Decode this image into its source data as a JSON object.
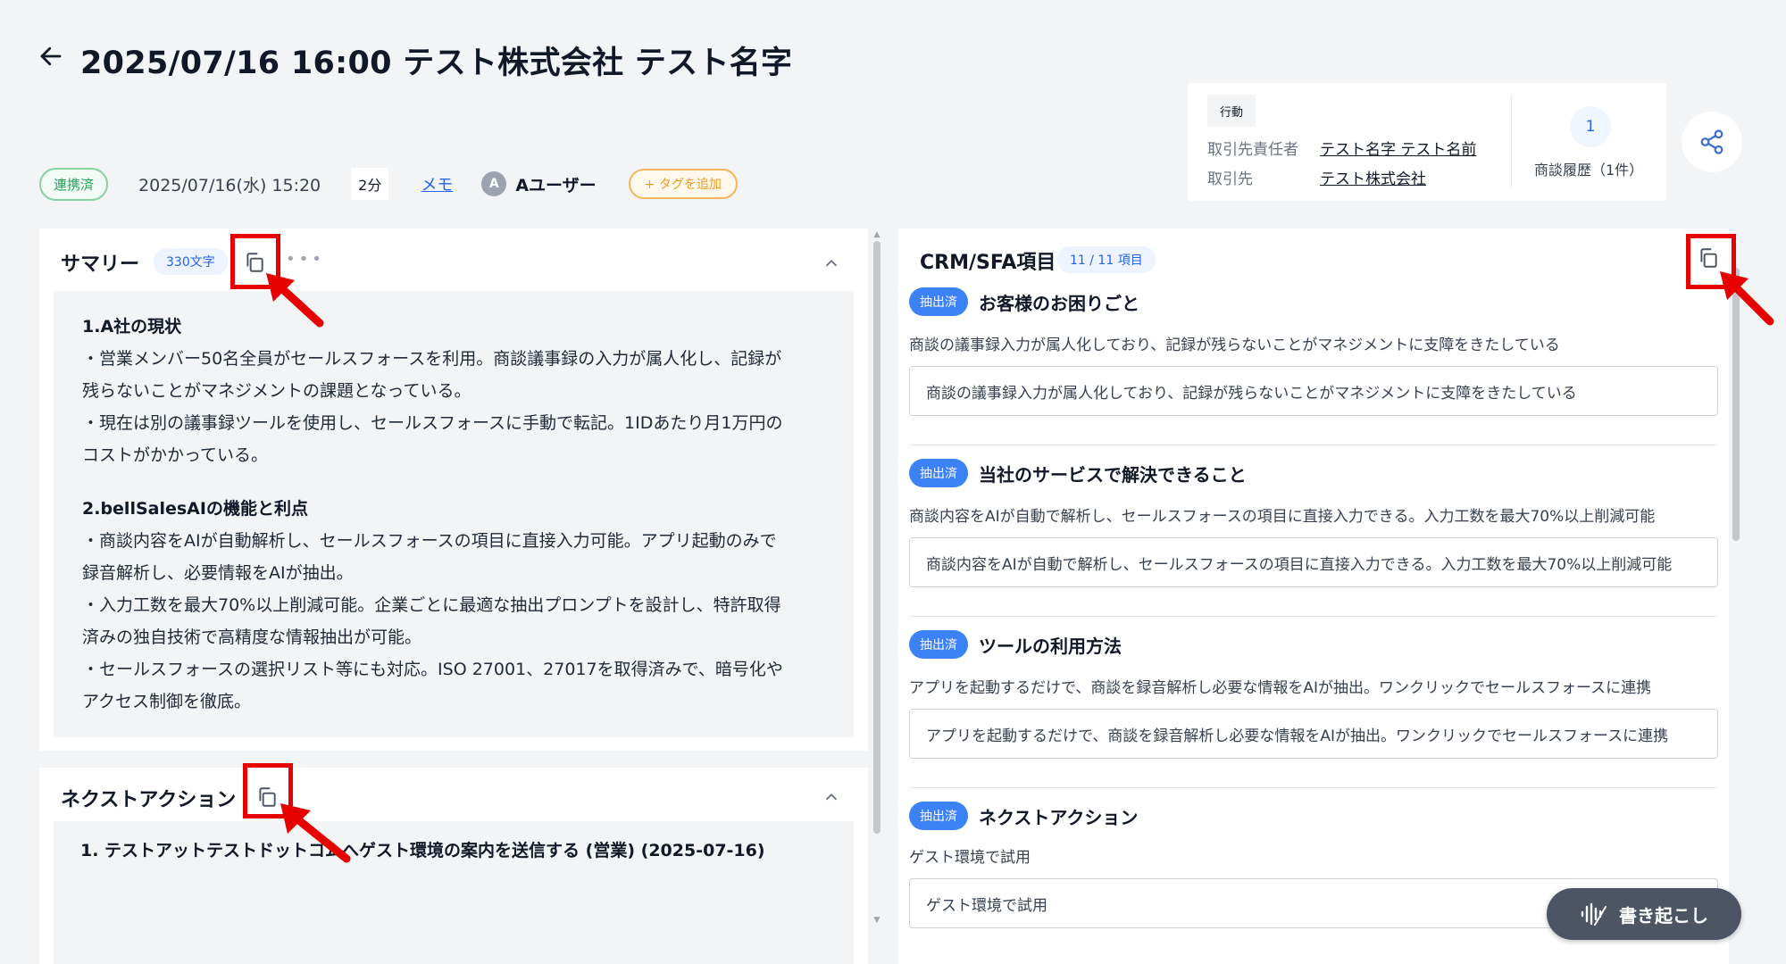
{
  "header": {
    "title": "2025/07/16 16:00 テスト株式会社 テスト名字"
  },
  "meta": {
    "status": "連携済",
    "datetime": "2025/07/16(水) 15:20",
    "duration": "2分",
    "memo": "メモ",
    "avatar_initial": "A",
    "user": "Aユーザー",
    "add_tag": "+ タグを追加"
  },
  "info_card": {
    "action": "行動",
    "contact_label": "取引先責任者",
    "contact_value": "テスト名字 テスト名前",
    "account_label": "取引先",
    "account_value": "テスト株式会社",
    "history_count": "1",
    "history_label": "商談履歴（1件）"
  },
  "summary": {
    "title": "サマリー",
    "count": "330文字",
    "sections": [
      {
        "title": "1.A社の現状",
        "lines": [
          "・営業メンバー50名全員がセールスフォースを利用。商談議事録の入力が属人化し、記録が",
          "残らないことがマネジメントの課題となっている。",
          "・現在は別の議事録ツールを使用し、セールスフォースに手動で転記。1IDあたり月1万円の",
          "コストがかかっている。"
        ]
      },
      {
        "title": "2.bellSalesAIの機能と利点",
        "lines": [
          "・商談内容をAIが自動解析し、セールスフォースの項目に直接入力可能。アプリ起動のみで",
          "録音解析し、必要情報をAIが抽出。",
          "・入力工数を最大70%以上削減可能。企業ごとに最適な抽出プロンプトを設計し、特許取得",
          "済みの独自技術で高精度な情報抽出が可能。",
          "・セールスフォースの選択リスト等にも対応。ISO 27001、27017を取得済みで、暗号化や",
          "アクセス制御を徹底。"
        ]
      }
    ]
  },
  "next_action": {
    "title": "ネクストアクション",
    "items": [
      "1. テストアットテストドットコムへゲスト環境の案内を送信する (営業) (2025-07-16)"
    ]
  },
  "crm": {
    "title": "CRM/SFA項目",
    "count": "11 / 11 項目",
    "items": [
      {
        "badge": "抽出済",
        "title": "お客様のお困りごと",
        "desc": "商談の議事録入力が属人化しており、記録が残らないことがマネジメントに支障をきたしている",
        "value": "商談の議事録入力が属人化しており、記録が残らないことがマネジメントに支障をきたしている"
      },
      {
        "badge": "抽出済",
        "title": "当社のサービスで解決できること",
        "desc": "商談内容をAIが自動で解析し、セールスフォースの項目に直接入力できる。入力工数を最大70%以上削減可能",
        "value": "商談内容をAIが自動で解析し、セールスフォースの項目に直接入力できる。入力工数を最大70%以上削減可能"
      },
      {
        "badge": "抽出済",
        "title": "ツールの利用方法",
        "desc": "アプリを起動するだけで、商談を録音解析し必要な情報をAIが抽出。ワンクリックでセールスフォースに連携",
        "value": "アプリを起動するだけで、商談を録音解析し必要な情報をAIが抽出。ワンクリックでセールスフォースに連携"
      },
      {
        "badge": "抽出済",
        "title": "ネクストアクション",
        "desc": "ゲスト環境で試用",
        "value": "ゲスト環境で試用"
      }
    ]
  },
  "transcribe_button": "書き起こし",
  "colors": {
    "accent": "#3b82f6",
    "annotation": "#e60000",
    "status_green": "#22a35a",
    "tag_orange": "#f29a1c"
  }
}
